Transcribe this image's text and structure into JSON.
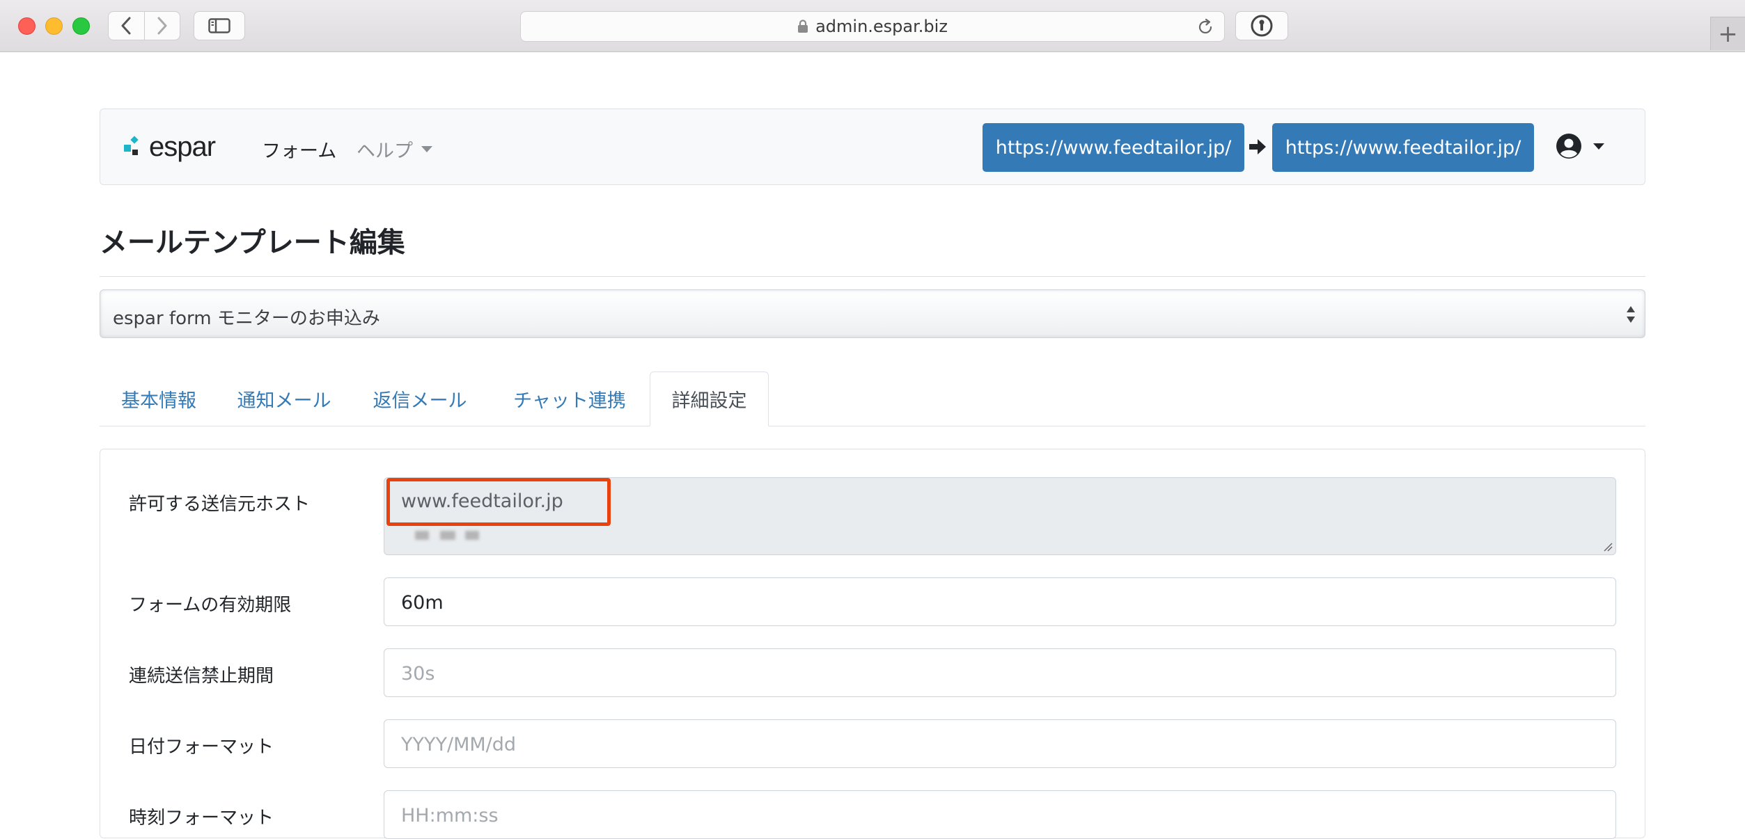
{
  "browser": {
    "url": "admin.espar.biz",
    "new_tab": "+"
  },
  "navbar": {
    "logo_text": "espar",
    "form_link": "フォーム",
    "help_link": "ヘルプ",
    "site_from": "https://www.feedtailor.jp/",
    "site_to": "https://www.feedtailor.jp/",
    "icons": [
      "user-circle-icon",
      "arrow-right-icon",
      "caret-down-icon"
    ]
  },
  "page": {
    "title": "メールテンプレート編集"
  },
  "form_select": {
    "value": "espar form モニターのお申込み"
  },
  "tabs": [
    {
      "label": "基本情報",
      "active": false
    },
    {
      "label": "通知メール",
      "active": false
    },
    {
      "label": "返信メール",
      "active": false
    },
    {
      "label": "チャット連携",
      "active": false
    },
    {
      "label": "詳細設定",
      "active": true
    }
  ],
  "settings": {
    "allowed_hosts": {
      "label": "許可する送信元ホスト",
      "value": "www.feedtailor.jp"
    },
    "form_expiry": {
      "label": "フォームの有効期限",
      "value": "60m"
    },
    "resubmit_block": {
      "label": "連続送信禁止期間",
      "placeholder": "30s"
    },
    "date_format": {
      "label": "日付フォーマット",
      "placeholder": "YYYY/MM/dd"
    },
    "time_format": {
      "label": "時刻フォーマット",
      "placeholder": "HH:mm:ss"
    }
  },
  "colors": {
    "primary": "#337ab7",
    "highlight": "#e8430f",
    "logo_teal": "#1fb5c8"
  }
}
